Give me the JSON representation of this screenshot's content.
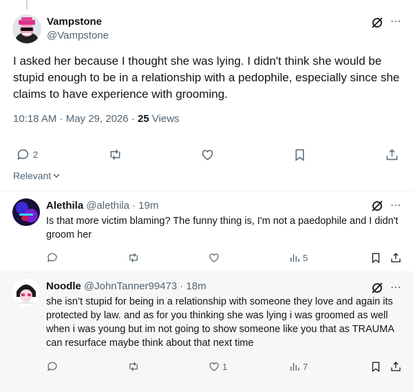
{
  "main_tweet": {
    "display_name": "Vampstone",
    "handle": "@Vampstone",
    "text": "I asked her because I thought she was lying. I didn't think she would be stupid enough to be in a relationship with a pedophile, especially since she claims to have experience with grooming.",
    "timestamp": "10:18 AM · May 29, 2026 · ",
    "views_count": "25",
    "views_label": " Views",
    "reply_count": "2",
    "more_icon": "⋯"
  },
  "sort": {
    "label": "Relevant"
  },
  "replies": [
    {
      "display_name": "Alethila",
      "handle": "@alethila",
      "time": "· 19m",
      "text": "Is that more victim blaming? The funny thing is, I'm not a paedophile and I didn't groom her",
      "reply_count": "",
      "like_count": "",
      "view_count": "5"
    },
    {
      "display_name": "Noodle",
      "handle": "@JohnTanner99473",
      "time": "· 18m",
      "text": "she isn’t stupid for being in a relationship with someone they love and again its protected by law. and as for you thinking she was lying i was groomed as well when i was young but im not going to show someone like you that as TRAUMA can resurface maybe think about that next time",
      "reply_count": "",
      "like_count": "1",
      "view_count": "7"
    }
  ],
  "colors": {
    "text_primary": "#0f1419",
    "text_secondary": "#536471",
    "divider": "#eff3f4",
    "highlight_bg": "#f7f7f7"
  },
  "icons": [
    "grok-icon",
    "more-icon",
    "reply-icon",
    "retweet-icon",
    "like-icon",
    "bookmark-icon",
    "share-icon",
    "views-icon",
    "chevron-down-icon"
  ]
}
